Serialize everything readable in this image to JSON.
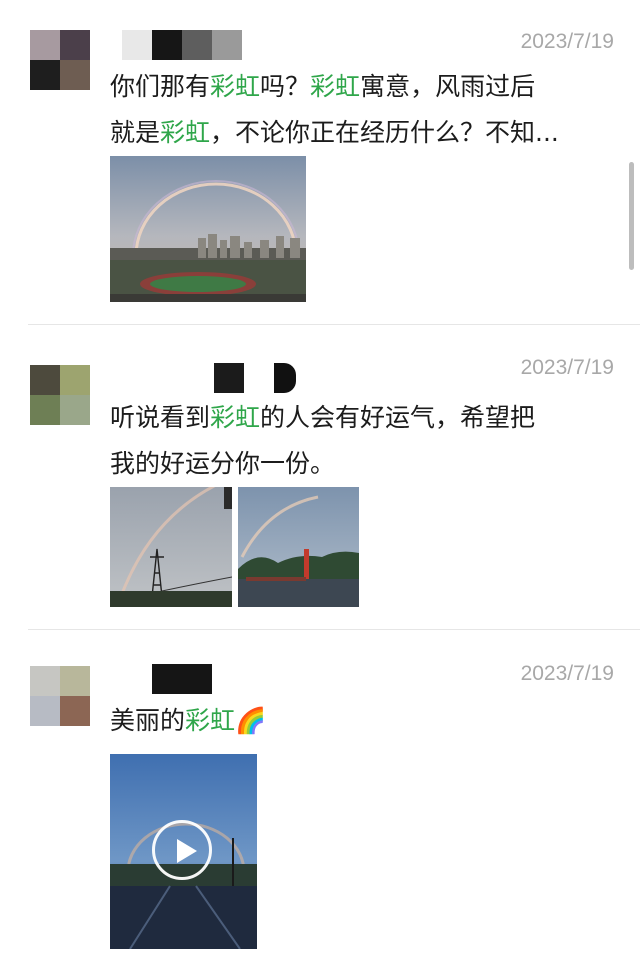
{
  "posts": [
    {
      "date": "2023/7/19",
      "text_lines": [
        [
          {
            "t": "你们那有"
          },
          {
            "t": "彩虹",
            "kw": true
          },
          {
            "t": "吗？"
          },
          {
            "t": "彩虹",
            "kw": true
          },
          {
            "t": "寓意，风雨过后"
          }
        ],
        [
          {
            "t": "就是"
          },
          {
            "t": "彩虹",
            "kw": true
          },
          {
            "t": "，不论你正在经历什么？不知..."
          }
        ]
      ],
      "avatar_colors": [
        "#a79aa0",
        "#4b3f4a",
        "#1e1e1e",
        "#6e5d52"
      ]
    },
    {
      "date": "2023/7/19",
      "text_lines": [
        [
          {
            "t": "听说看到"
          },
          {
            "t": "彩虹",
            "kw": true
          },
          {
            "t": "的人会有好运气，希望把"
          }
        ],
        [
          {
            "t": "我的好运分你一份。"
          }
        ]
      ],
      "avatar_colors": [
        "#4d4a3d",
        "#9da46f",
        "#6e7f55",
        "#9aa78a"
      ]
    },
    {
      "date": "2023/7/19",
      "text_lines": [
        [
          {
            "t": "美丽的"
          },
          {
            "t": "彩虹",
            "kw": true
          },
          {
            "t": "🌈"
          }
        ]
      ],
      "avatar_colors": [
        "#c6c6c2",
        "#b8b79b",
        "#b7bbc4",
        "#8c6654"
      ]
    }
  ],
  "colors": {
    "keyword": "#2fa64a",
    "date": "#a8a8a8",
    "divider": "#e6e6e6"
  },
  "icons": {
    "video_play": "play-icon",
    "rainbow_emoji": "rainbow-icon"
  }
}
